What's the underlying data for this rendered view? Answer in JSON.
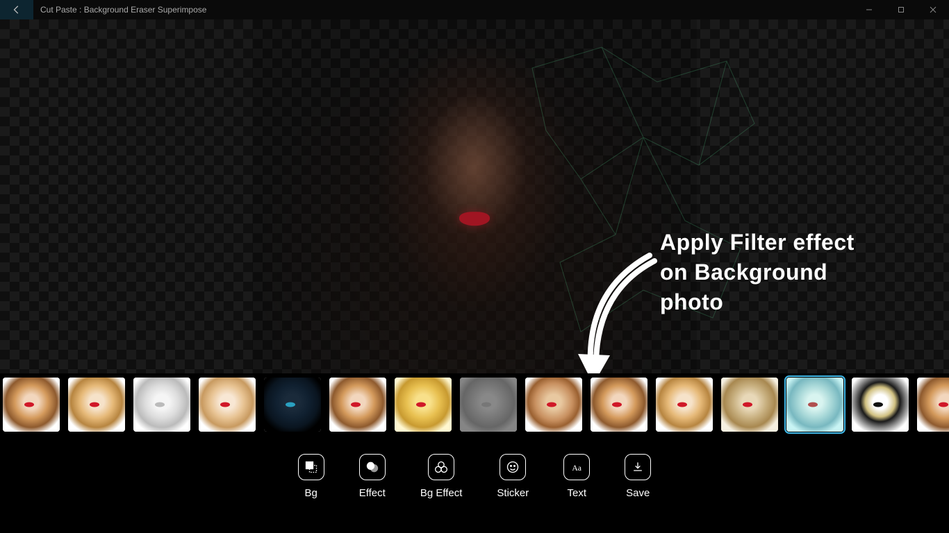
{
  "titlebar": {
    "title": "Cut Paste : Background Eraser Superimpose"
  },
  "callout": {
    "line1": "Apply Filter effect",
    "line2": "on Background",
    "line3": "photo"
  },
  "filters": [
    {
      "name": "filter-1",
      "tint": "t-original",
      "selected": false
    },
    {
      "name": "filter-2",
      "tint": "t-blonde",
      "selected": false
    },
    {
      "name": "filter-3",
      "tint": "t-sketch",
      "selected": false
    },
    {
      "name": "filter-4",
      "tint": "t-light",
      "selected": false
    },
    {
      "name": "filter-5",
      "tint": "t-invert",
      "selected": false
    },
    {
      "name": "filter-6",
      "tint": "t-original",
      "selected": false
    },
    {
      "name": "filter-7",
      "tint": "t-yellow",
      "selected": false
    },
    {
      "name": "filter-8",
      "tint": "t-emboss",
      "selected": false
    },
    {
      "name": "filter-9",
      "tint": "t-poster",
      "selected": false
    },
    {
      "name": "filter-10",
      "tint": "t-original",
      "selected": false
    },
    {
      "name": "filter-11",
      "tint": "t-blonde",
      "selected": false
    },
    {
      "name": "filter-12",
      "tint": "t-sepia",
      "selected": false
    },
    {
      "name": "filter-13",
      "tint": "t-cyan",
      "selected": true
    },
    {
      "name": "filter-14",
      "tint": "t-ink",
      "selected": false
    },
    {
      "name": "filter-15",
      "tint": "t-original",
      "selected": false
    }
  ],
  "toolbar": {
    "bg": "Bg",
    "effect": "Effect",
    "bg_effect": "Bg Effect",
    "sticker": "Sticker",
    "text": "Text",
    "save": "Save"
  }
}
